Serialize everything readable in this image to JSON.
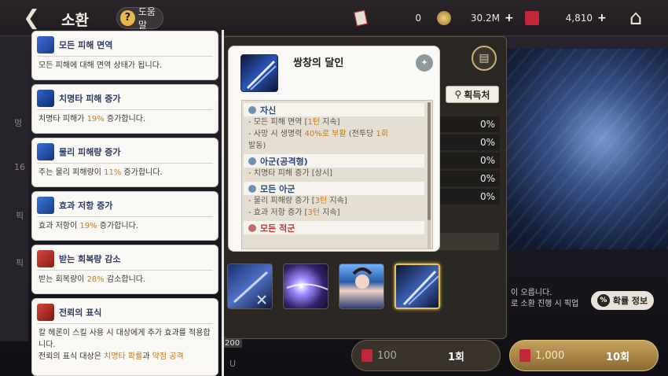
{
  "header": {
    "title": "소환",
    "help_label": "도움말",
    "currencies": [
      {
        "icon": "scroll-icon",
        "value": "0"
      },
      {
        "icon": "gold-coin-icon",
        "value": "30.2M"
      },
      {
        "icon": "ticket-icon",
        "value": "4,810"
      }
    ]
  },
  "background": {
    "left_fragments": [
      "멍",
      "16",
      "픽",
      "픽"
    ],
    "summon_note_line1": "이 오릅니다.",
    "summon_note_line2": "로 소환 진행 시 픽업",
    "level_badge": "200",
    "level_suffix": "U"
  },
  "panel": {
    "acquire_label": "획득처",
    "percent_rows": [
      "0%",
      "0%",
      "0%",
      "0%",
      "0%"
    ],
    "probability_label": "확률 정보",
    "summon_one": {
      "cost": "100",
      "label": "1회"
    },
    "summon_ten": {
      "cost": "1,000",
      "label": "10회"
    }
  },
  "skill_card": {
    "title": "쌍창의 달인",
    "groups": [
      {
        "target": "자신",
        "lines": [
          {
            "pre": "- 모든 피해 면역 [",
            "hl": "1턴",
            "post": " 지속]"
          },
          {
            "pre": "- 사망 시 생명력 ",
            "hl": "40%로 부활",
            "post": " (전투당 ",
            "hl2": "1회",
            "post2": ""
          },
          {
            "pre": "발동)",
            "hl": "",
            "post": ""
          }
        ]
      },
      {
        "target": "아군(공격형)",
        "lines": [
          {
            "pre": "- 치명타 피해 증가 [상시]",
            "hl": "",
            "post": ""
          }
        ]
      },
      {
        "target": "모든 아군",
        "lines": [
          {
            "pre": "- 물리 피해량 증가 [",
            "hl": "3턴",
            "post": " 지속]"
          },
          {
            "pre": "- 효과 저항 증가 [",
            "hl": "3턴",
            "post": " 지속]"
          }
        ]
      },
      {
        "target": "모든 적군",
        "lines": []
      }
    ]
  },
  "tooltips": [
    {
      "name": "모든 피해 면역",
      "pre": "모든 피해에 대해 면역 상태가 됩니다.",
      "hl": "",
      "post": ""
    },
    {
      "name": "치명타 피해 증가",
      "pre": "치명타 피해가 ",
      "hl": "19%",
      "post": " 증가합니다."
    },
    {
      "name": "물리 피해량 증가",
      "pre": "주는 물리 피해량이 ",
      "hl": "11%",
      "post": " 증가합니다."
    },
    {
      "name": "효과 저항 증가",
      "pre": "효과 저항이 ",
      "hl": "19%",
      "post": " 증가합니다."
    },
    {
      "name": "받는 회복량 감소",
      "pre": "받는 회복량이 ",
      "hl": "28%",
      "post": " 감소합니다."
    },
    {
      "name": "전뢰의 표식",
      "pre": "칼 헤론이 스킬 사용 시 대상에게 추가 효과를 적용합니다.",
      "line2_pre": "전뢰의 표식 대상은 ",
      "line2_hl": "치명타 확률",
      "line2_mid": "과 ",
      "line2_hl2": "약점 공격"
    }
  ],
  "colors": {
    "highlight": "#c87a1c",
    "gold_button": "#c6a25c"
  }
}
